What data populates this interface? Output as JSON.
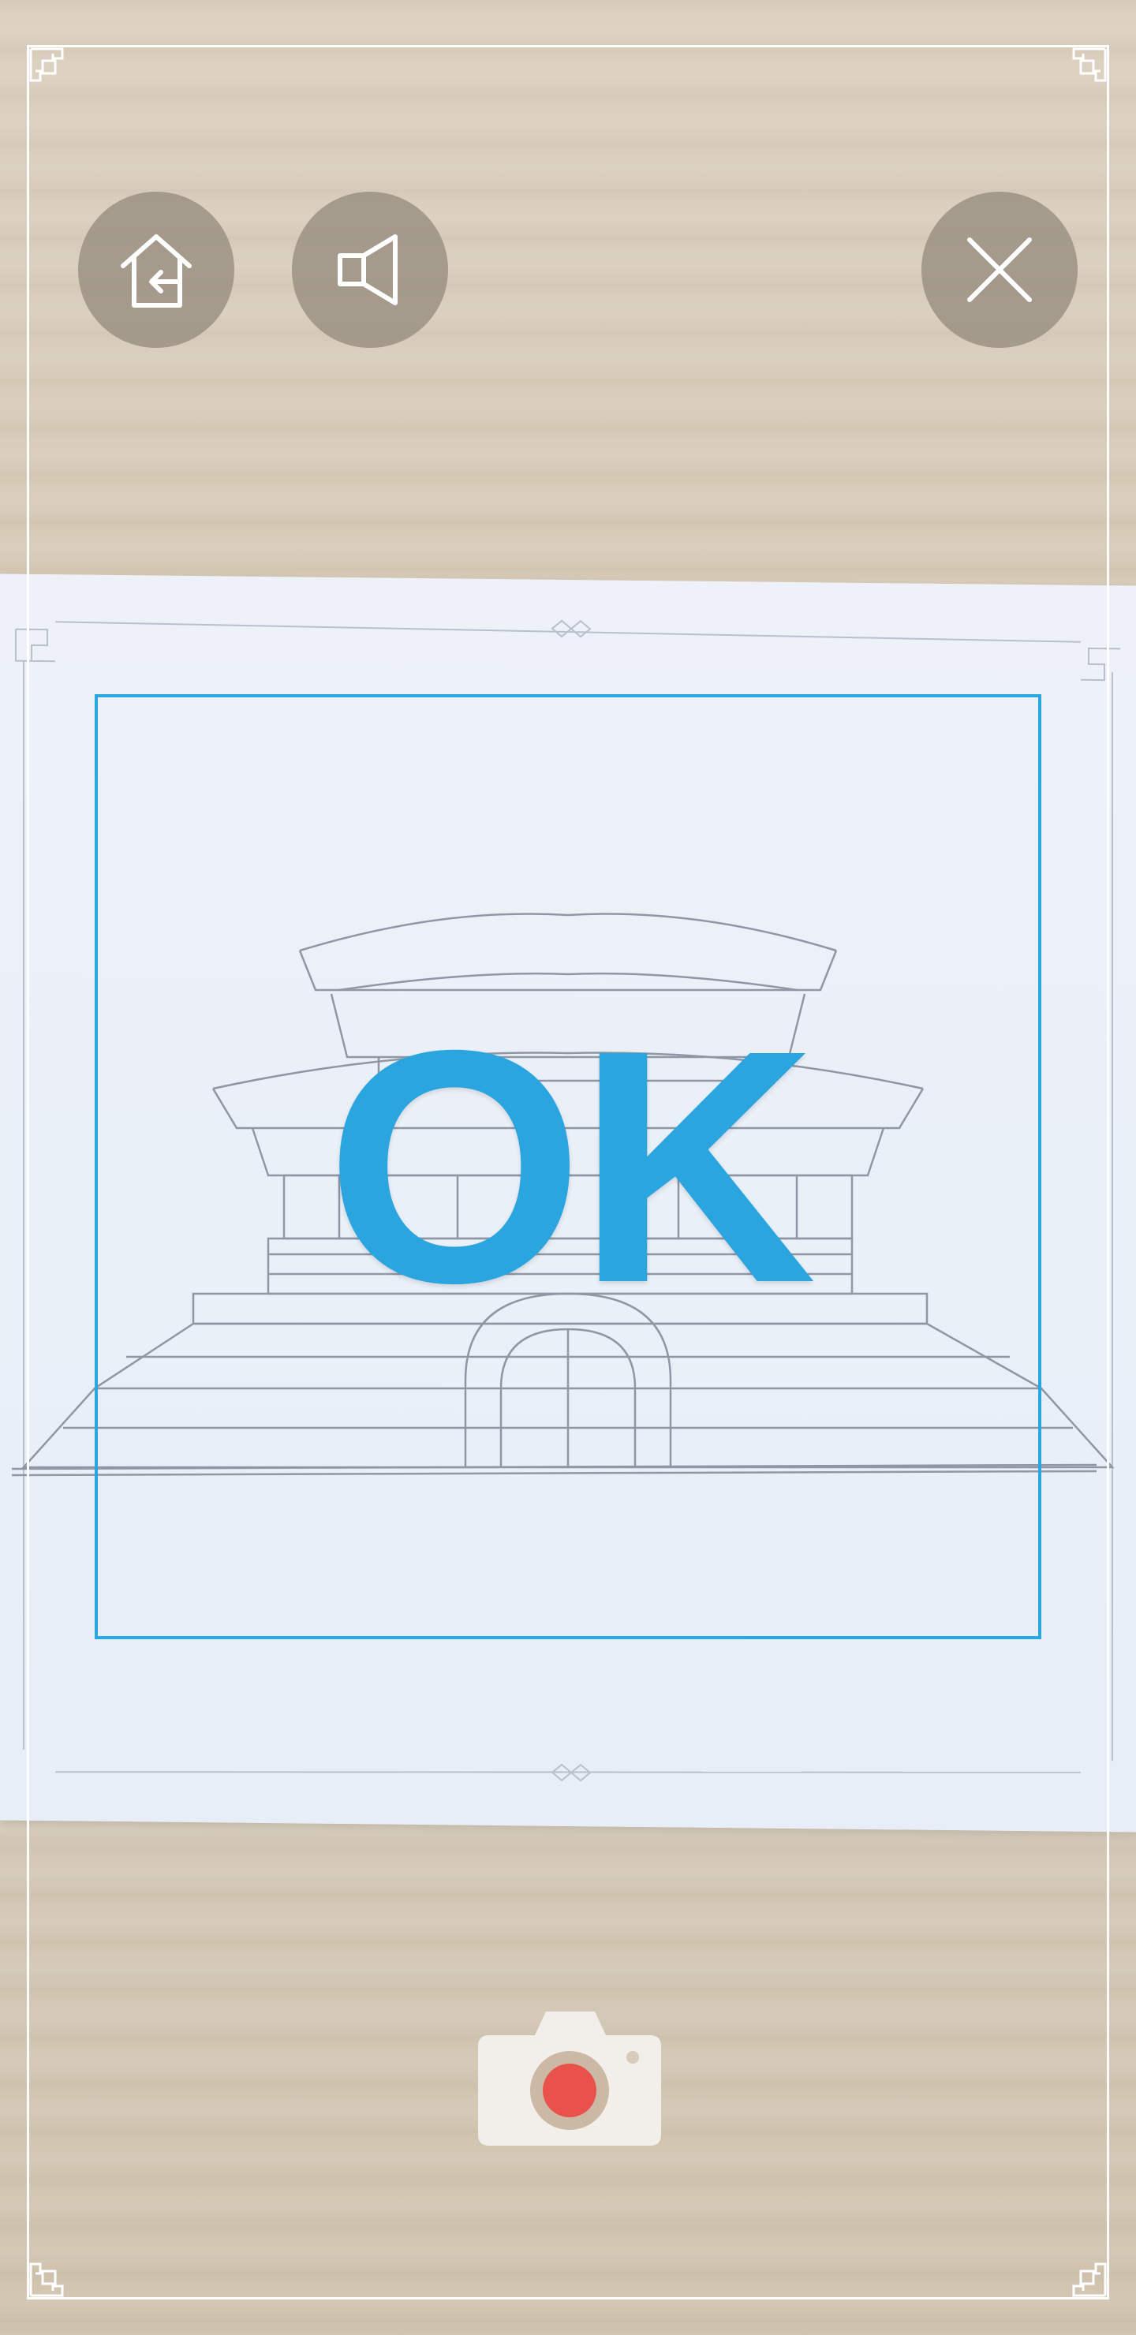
{
  "overlay": {
    "status_text": "OK",
    "accent_color": "#29a7df"
  },
  "toolbar": {
    "home_icon": "home-back-icon",
    "sound_icon": "speaker-icon",
    "close_icon": "close-icon"
  },
  "capture": {
    "shutter_icon": "camera-icon",
    "record_color": "#e8524a"
  }
}
